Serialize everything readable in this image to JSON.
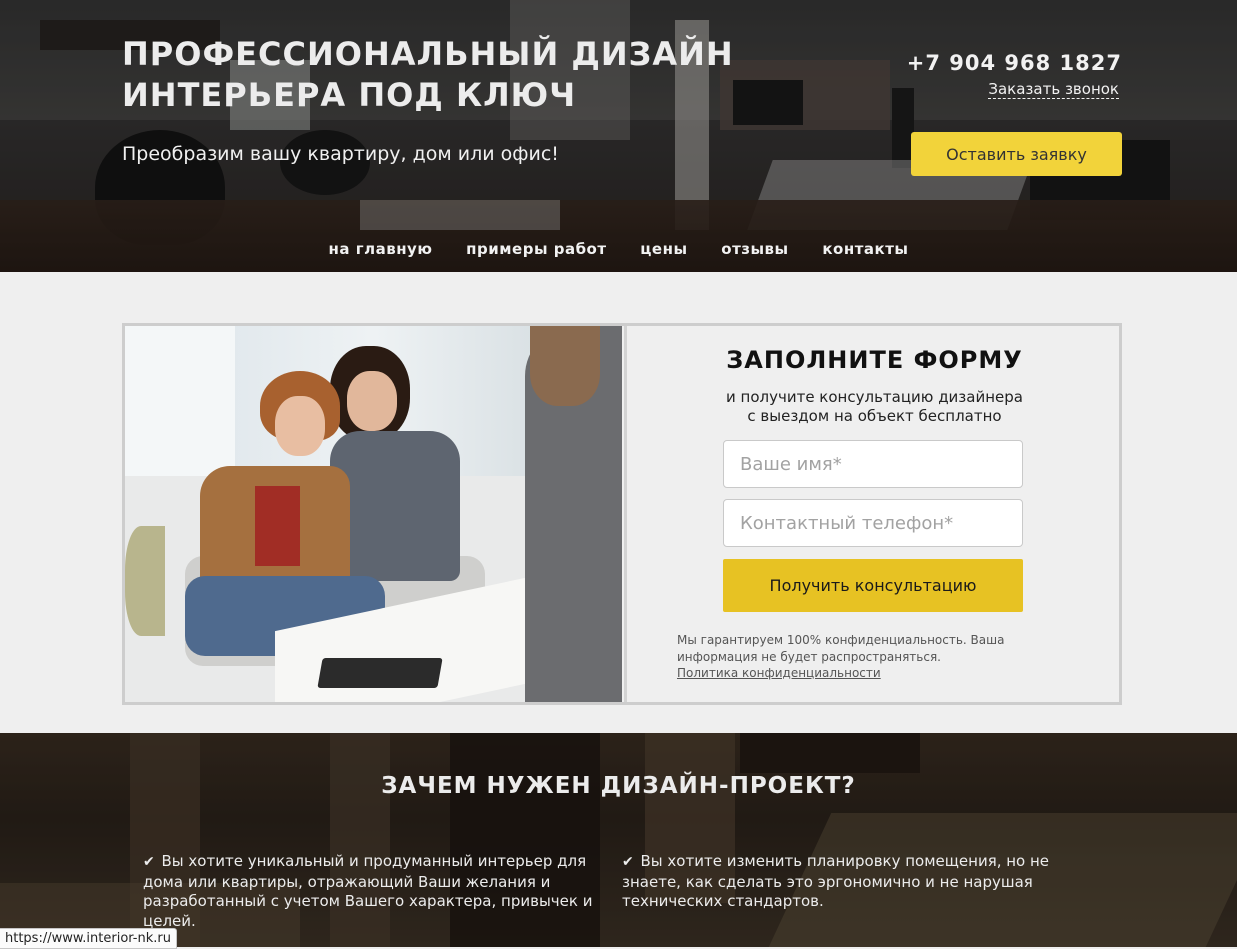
{
  "hero": {
    "title": "ПРОФЕССИОНАЛЬНЫЙ ДИЗАЙН ИНТЕРЬЕРА ПОД КЛЮЧ",
    "subtitle": "Преобразим вашу квартиру, дом или офис!",
    "phone": "+7 904 968 1827",
    "callback_label": "Заказать звонок",
    "request_button": "Оставить заявку"
  },
  "nav": {
    "items": [
      {
        "label": "на главную"
      },
      {
        "label": "примеры работ"
      },
      {
        "label": "цены"
      },
      {
        "label": "отзывы"
      },
      {
        "label": "контакты"
      }
    ]
  },
  "form": {
    "title": "ЗАПОЛНИТЕ ФОРМУ",
    "desc_line1": "и получите консультацию дизайнера",
    "desc_line2": "с выездом на объект бесплатно",
    "name_placeholder": "Ваше имя*",
    "phone_placeholder": "Контактный телефон*",
    "submit": "Получить консультацию",
    "privacy_text": "Мы гарантируем 100% конфиденциальность. Ваша информация не будет распространяться.",
    "privacy_link": "Политика конфиденциальности"
  },
  "why": {
    "title": "ЗАЧЕМ НУЖЕН ДИЗАЙН-ПРОЕКТ?",
    "items": [
      {
        "text": "Вы хотите уникальный и продуманный интерьер для дома или квартиры, отражающий Ваши желания и разработанный с учетом Вашего характера, привычек и целей."
      },
      {
        "text": "Вы хотите изменить планировку помещения, но не знаете, как сделать это эргономично и не нарушая технических стандартов."
      }
    ]
  },
  "status_bar": {
    "url": "https://www.interior-nk.ru"
  },
  "colors": {
    "accent_yellow": "#f2d33a",
    "button_yellow": "#e7c223"
  },
  "icons": {
    "check": "check-icon"
  }
}
